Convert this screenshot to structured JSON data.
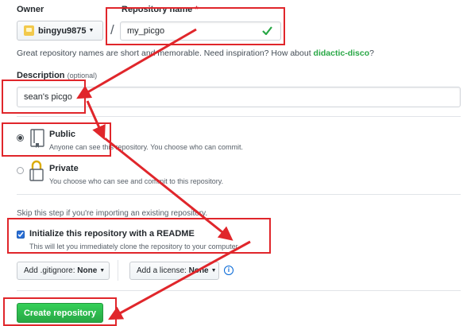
{
  "owner": {
    "label": "Owner",
    "username": "bingyu9875",
    "separator": "/"
  },
  "repo": {
    "label": "Repository name",
    "required_mark": "*",
    "value": "my_picgo"
  },
  "hint": {
    "text": "Great repository names are short and memorable. Need inspiration? How about ",
    "suggestion": "didactic-disco",
    "end": "?"
  },
  "description": {
    "label": "Description",
    "optional": "(optional)",
    "value": "sean's picgo"
  },
  "visibility": {
    "public_label": "Public",
    "public_desc": "Anyone can see this repository. You choose who can commit.",
    "private_label": "Private",
    "private_desc": "You choose who can see and commit to this repository.",
    "selected": "public"
  },
  "init": {
    "skip_text": "Skip this step if you're importing an existing repository.",
    "readme_label": "Initialize this repository with a README",
    "readme_desc": "This will let you immediately clone the repository to your computer.",
    "readme_checked": true
  },
  "options": {
    "gitignore_label": "Add .gitignore:",
    "gitignore_value": "None",
    "license_label": "Add a license:",
    "license_value": "None"
  },
  "submit": {
    "label": "Create repository"
  },
  "colors": {
    "annotation_red": "#e0262b",
    "create_green": "#2cbe4e",
    "valid_check": "#28a745"
  }
}
